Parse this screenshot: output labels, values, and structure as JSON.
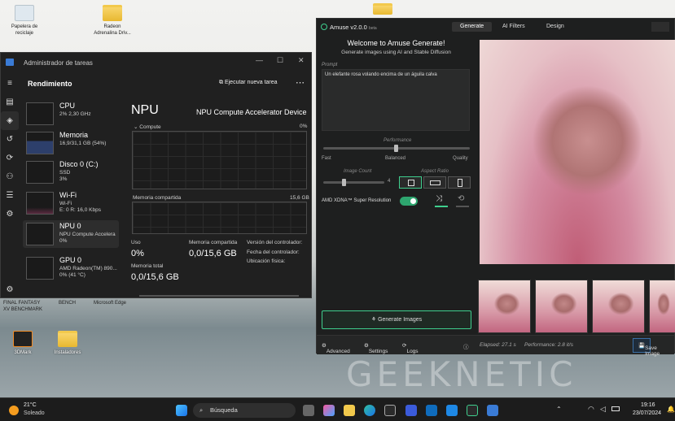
{
  "desktop": {
    "icons": [
      {
        "label": "Papelera de\nreciclaje"
      },
      {
        "label": "Radeon\nAdrenalina Driv..."
      },
      {
        "label": ""
      }
    ],
    "lower_labels": [
      "FINAL FANTASY\nXV BENCHMARK",
      "BENCH",
      "Microsoft Edge"
    ],
    "bottom_icons": [
      {
        "label": "3DMark"
      },
      {
        "label": "Instaladores"
      }
    ]
  },
  "task_manager": {
    "title": "Administrador de tareas",
    "section": "Rendimiento",
    "run_task": "Ejecutar nueva tarea",
    "items": [
      {
        "name": "CPU",
        "sub1": "2%  2,30 GHz",
        "sub2": ""
      },
      {
        "name": "Memoria",
        "sub1": "16,9/31,1 GB (54%)",
        "sub2": ""
      },
      {
        "name": "Disco 0 (C:)",
        "sub1": "SSD",
        "sub2": "3%"
      },
      {
        "name": "Wi-Fi",
        "sub1": "Wi-Fi",
        "sub2": "E: 0  R: 16,0 Kbps"
      },
      {
        "name": "NPU 0",
        "sub1": "NPU Compute Accelera",
        "sub2": "0%"
      },
      {
        "name": "GPU 0",
        "sub1": "AMD Radeon(TM) 890...",
        "sub2": "0%  (41 °C)"
      }
    ],
    "detail_title": "NPU",
    "detail_device": "NPU Compute Accelerator Device",
    "graph1_label": "Compute",
    "graph1_pct": "0%",
    "graph2_label": "Memoria compartida",
    "graph2_max": "15,6 GB",
    "stats": {
      "uso_label": "Uso",
      "uso_value": "0%",
      "mem_shared_label": "Memoria compartida",
      "mem_shared_value": "0,0/15,6 GB",
      "mem_total_label": "Memoria total",
      "mem_total_value": "0,0/15,6 GB",
      "driver_version": "Versión del controlador:",
      "driver_date": "Fecha del controlador:",
      "phys_location": "Ubicación física:"
    }
  },
  "amuse": {
    "title": "Amuse v2.0.0",
    "title_suffix": "beta",
    "tabs": [
      "Generate",
      "AI Filters",
      "Design"
    ],
    "welcome": "Welcome to Amuse Generate!",
    "welcome_sub": "Generate images using AI and Stable Diffusion",
    "prompt_label": "Prompt",
    "prompt_text": "Un elefante rosa volando encima de un águila calva",
    "performance_label": "Performance",
    "perf_fast": "Fast",
    "perf_balanced": "Balanced",
    "perf_quality": "Quality",
    "image_count_label": "Image Count",
    "image_count_value": "4",
    "aspect_ratio_label": "Aspect Ratio",
    "super_res_label": "AMD XDNA™ Super Resolution",
    "generate_button": "Generate Images",
    "bottom": {
      "advanced": "Advanced",
      "settings": "Settings",
      "logs": "Logs",
      "elapsed": "Elapsed: 27.1 s",
      "performance": "Performance: 2.8 it/s",
      "save": "Save Image"
    }
  },
  "watermark": "GEEKNETIC",
  "taskbar": {
    "weather_temp": "21°C",
    "weather_desc": "Soleado",
    "search_placeholder": "Búsqueda",
    "time": "19:16",
    "date": "23/07/2024"
  },
  "colors": {
    "accent_green": "#3fcf8e",
    "tm_bg": "#202020"
  }
}
